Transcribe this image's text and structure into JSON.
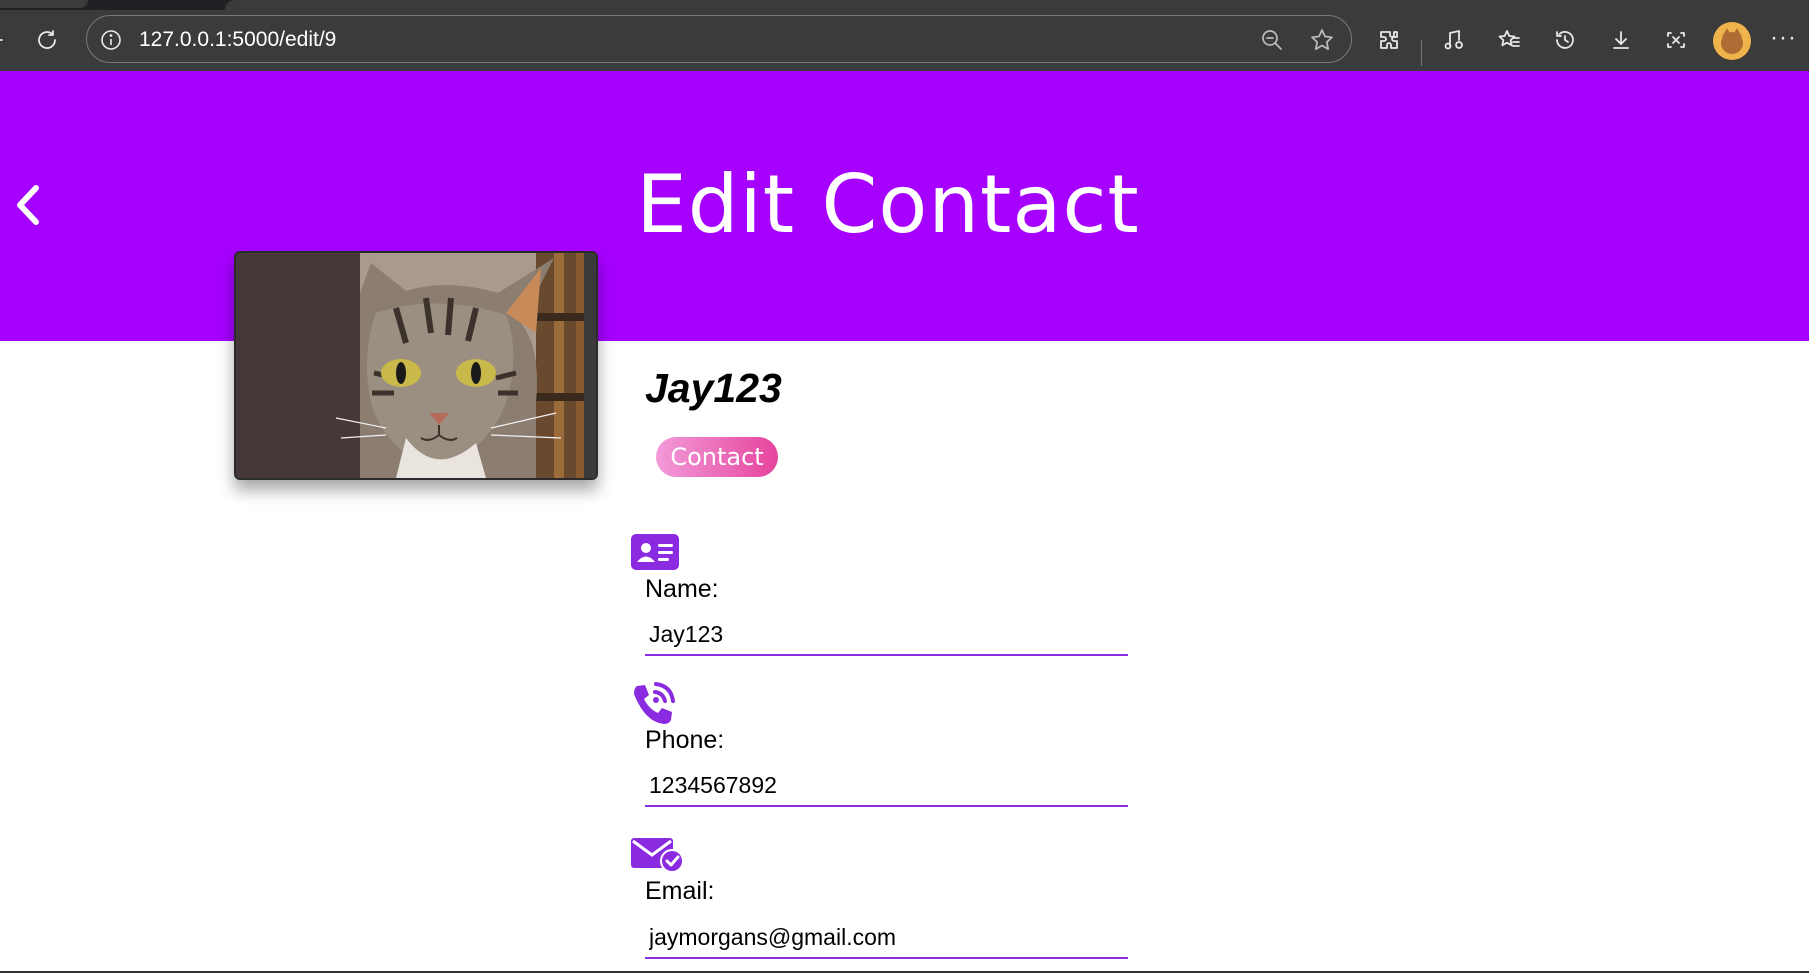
{
  "browser": {
    "url": "127.0.0.1:5000/edit/9",
    "icons": [
      "back-icon",
      "reload-icon",
      "site-info-icon",
      "zoom-out-icon",
      "favorite-star-icon",
      "extensions-icon",
      "media-icon",
      "favorites-icon",
      "history-icon",
      "downloads-icon",
      "screenshot-icon",
      "profile-avatar",
      "more-options-icon"
    ]
  },
  "header": {
    "title": "Edit Contact",
    "back_icon": "chevron-left-icon",
    "background_color": "#a600ff"
  },
  "profile": {
    "name": "Jay123",
    "badge_label": "Contact",
    "photo_icon": "cat-photo"
  },
  "form": {
    "name_label": "Name:",
    "name_value": "Jay123",
    "name_icon": "id-card-icon",
    "phone_label": "Phone:",
    "phone_value": "1234567892",
    "phone_icon": "phone-call-icon",
    "email_label": "Email:",
    "email_value": "jaymorgans@gmail.com",
    "email_icon": "envelope-check-icon",
    "accent_color": "#8a2be2"
  }
}
